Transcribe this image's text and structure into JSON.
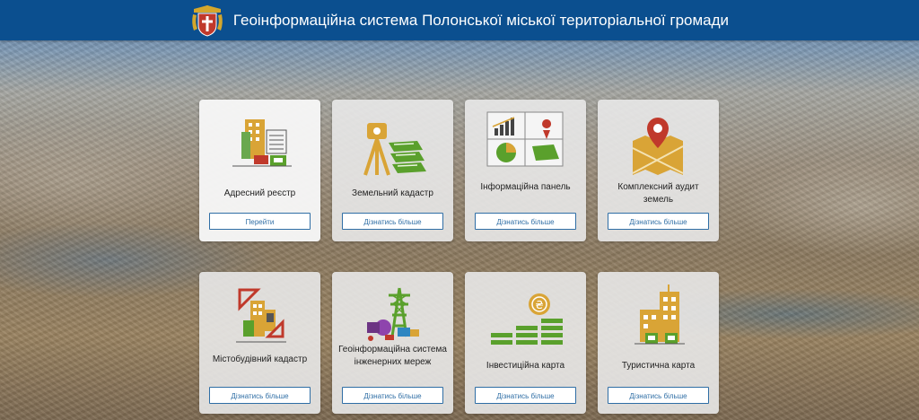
{
  "header": {
    "title": "Геоінформаційна система Полонської міської територіальної громади",
    "crest_icon": "coat-of-arms-icon"
  },
  "colors": {
    "header_bg": "#0b4f8f",
    "accent_gold": "#c9a227",
    "accent_green": "#5aa02c",
    "accent_red": "#c0392b",
    "button_border": "#2f6ea5"
  },
  "cards": [
    {
      "label": "Адресний реєстр",
      "button": "Перейти",
      "icon": "address-registry-icon"
    },
    {
      "label": "Земельний кадастр",
      "button": "Дізнатись більше",
      "icon": "land-cadastre-icon"
    },
    {
      "label": "Інформаційна панель",
      "button": "Дізнатись більше",
      "icon": "dashboard-icon"
    },
    {
      "label": "Комплексний аудит земель",
      "button": "Дізнатись більше",
      "icon": "land-audit-icon"
    },
    {
      "label": "Містобудівний кадастр",
      "button": "Дізнатись більше",
      "icon": "urban-cadastre-icon"
    },
    {
      "label": "Геоінформаційна система інженерних мереж",
      "button": "Дізнатись більше",
      "icon": "engineering-networks-icon"
    },
    {
      "label": "Інвестиційна карта",
      "button": "Дізнатись більше",
      "icon": "investment-map-icon"
    },
    {
      "label": "Туристична карта",
      "button": "Дізнатись більше",
      "icon": "tourist-map-icon"
    }
  ]
}
